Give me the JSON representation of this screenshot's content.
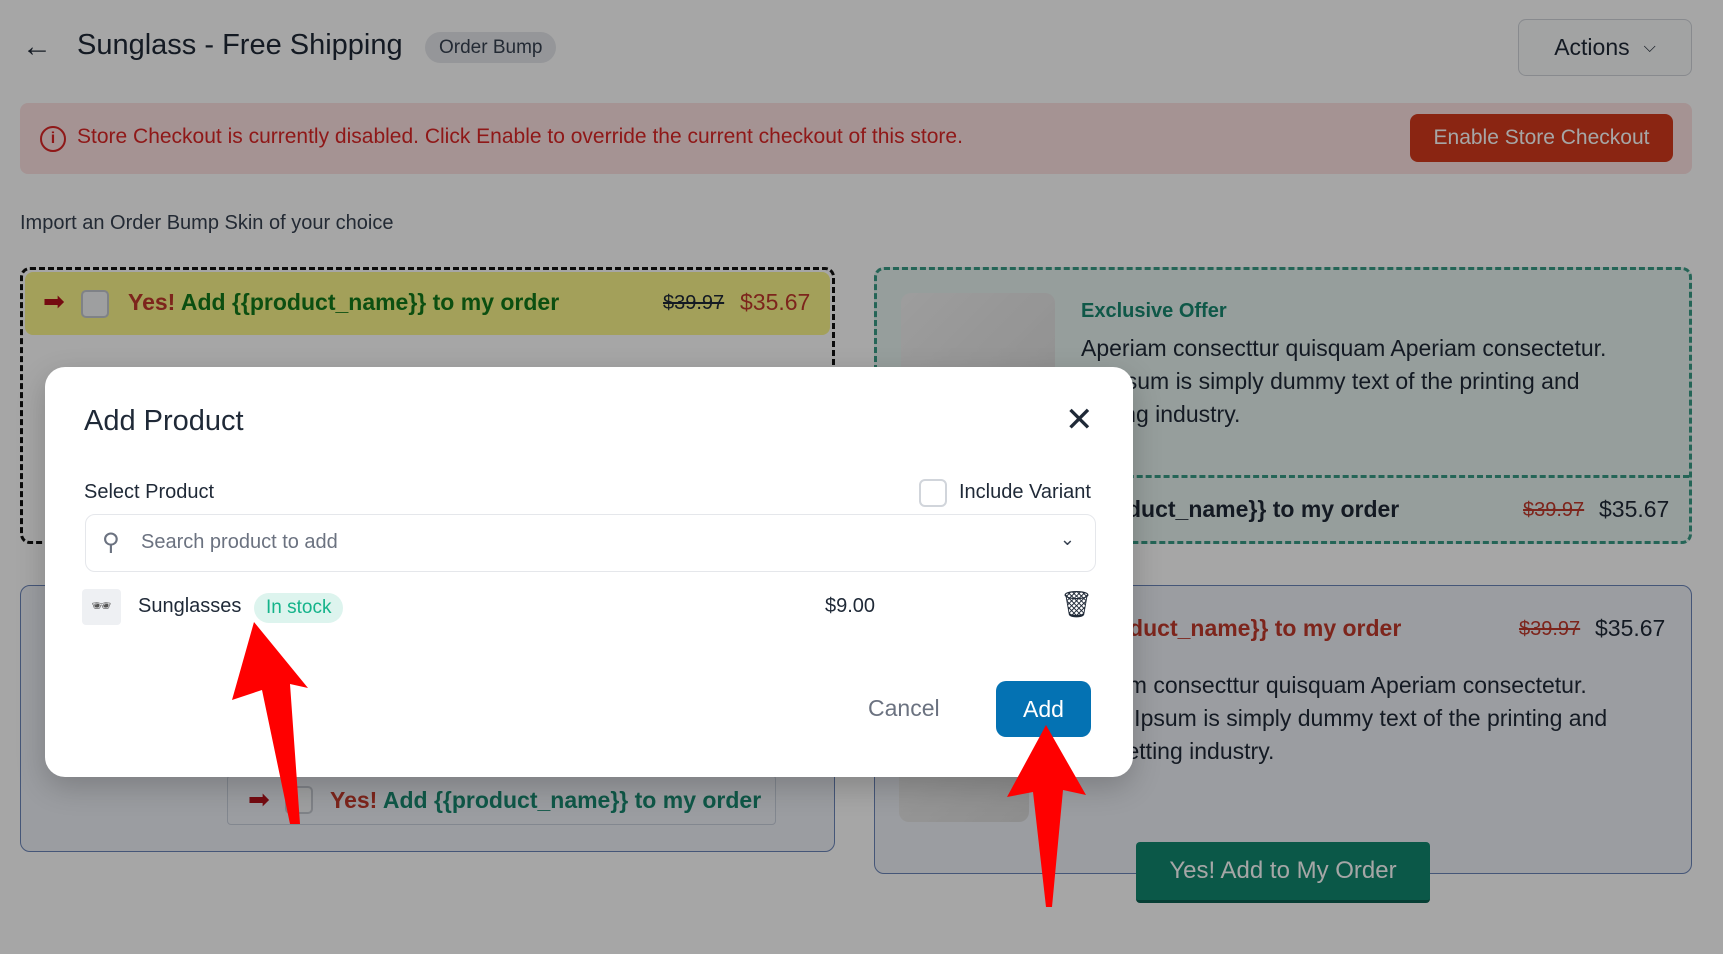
{
  "header": {
    "back_icon": "arrow-left-icon",
    "title": "Sunglass - Free Shipping",
    "badge": "Order Bump",
    "actions_label": "Actions"
  },
  "alert": {
    "message": "Store Checkout is currently disabled. Click Enable to override the current checkout of this store.",
    "button": "Enable Store Checkout",
    "color": "#dc2626"
  },
  "import_label": "Import an Order Bump Skin of your choice",
  "skins": {
    "s1": {
      "yes": "Yes!",
      "text": "Add {{product_name}} to my order",
      "old_price": "$39.97",
      "price": "$35.67"
    },
    "s2": {
      "heading": "Exclusive Offer",
      "body": [
        "Aperiam consecttur quisquam Aperiam consectetur.",
        "m Ipsum is simply dummy text of the printing and",
        "setting industry."
      ],
      "line": "duct_name}} to my order",
      "old_price": "$39.97",
      "price": "$35.67"
    },
    "s3": {
      "yes": "Yes!",
      "text": "Add {{product_name}} to my order"
    },
    "s4": {
      "line": "oduct_name}} to my order",
      "old_price": "$39.97",
      "price": "$35.67",
      "body": [
        "am consecttur quisquam Aperiam consectetur.",
        "n Ipsum is simply dummy text of the printing and",
        "setting industry."
      ],
      "button": "Yes! Add to My Order"
    }
  },
  "modal": {
    "title": "Add Product",
    "select_label": "Select Product",
    "include_variant": "Include Variant",
    "include_variant_checked": false,
    "search_placeholder": "Search product to add",
    "product": {
      "name": "Sunglasses",
      "stock": "In stock",
      "price": "$9.00"
    },
    "cancel": "Cancel",
    "add": "Add",
    "accent": "#0472b3"
  }
}
